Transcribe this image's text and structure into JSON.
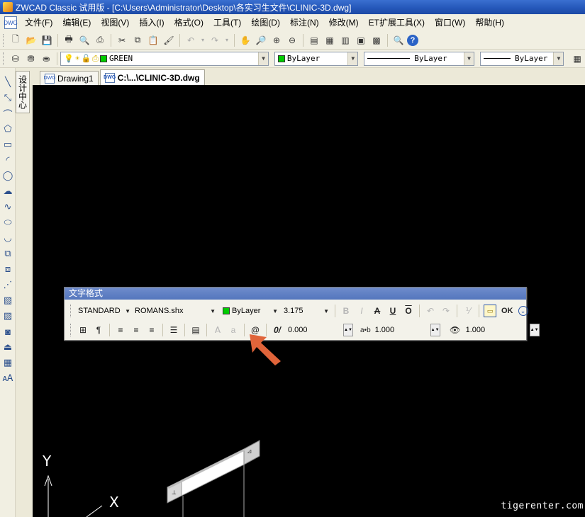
{
  "window": {
    "title": "ZWCAD Classic 试用版 - [C:\\Users\\Administrator\\Desktop\\各实习生文件\\CLINIC-3D.dwg]"
  },
  "menu": {
    "doc_icon": "DWG",
    "items": [
      "文件(F)",
      "编辑(E)",
      "视图(V)",
      "插入(I)",
      "格式(O)",
      "工具(T)",
      "绘图(D)",
      "标注(N)",
      "修改(M)",
      "ET扩展工具(X)",
      "窗口(W)",
      "帮助(H)"
    ]
  },
  "layer_toolbar": {
    "layer_name": "GREEN",
    "layer_color": "#00cc00",
    "color_value": "ByLayer",
    "color_swatch": "#00cc00",
    "linetype_value": "ByLayer",
    "lineweight_value": "ByLayer"
  },
  "tabs": [
    {
      "label": "Drawing1",
      "active": false
    },
    {
      "label": "C:\\...\\CLINIC-3D.dwg",
      "active": true
    }
  ],
  "design_center_label": "设计中心",
  "text_format": {
    "title": "文字格式",
    "style": "STANDARD",
    "font": "ROMANS.shx",
    "color": "ByLayer",
    "color_swatch": "#00cc00",
    "height": "3.175",
    "bold_label": "B",
    "italic_label": "I",
    "underline_label": "U",
    "ok_label": "OK",
    "oblique_value": "0.000",
    "tracking_label": "a•b",
    "tracking_value": "1.000",
    "width_value": "1.000"
  },
  "canvas": {
    "background": "#000000",
    "y_axis_label": "Y",
    "x_axis_label": "X"
  },
  "watermark": "tigerenter.com",
  "annotation_arrow_color": "#e0643a"
}
